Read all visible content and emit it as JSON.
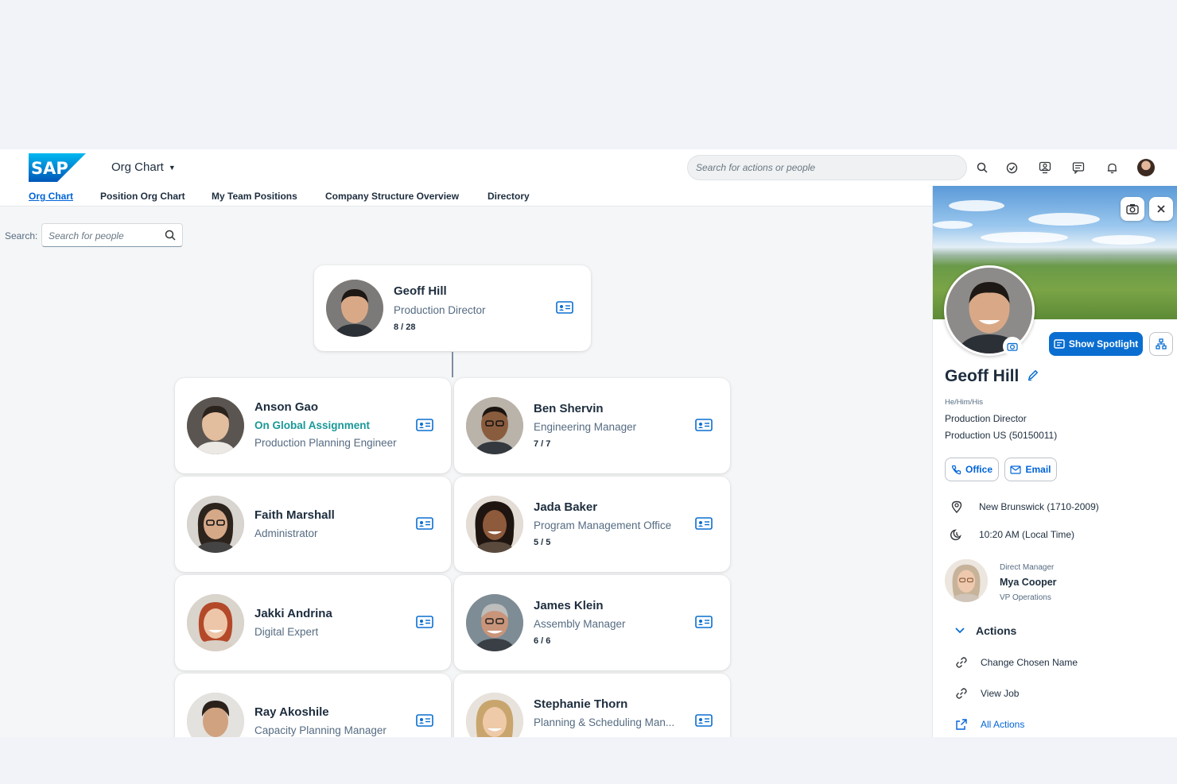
{
  "shell": {
    "logo_text": "SAP",
    "app_title": "Org Chart",
    "search_placeholder": "Search for actions or people",
    "icons": [
      "search-icon",
      "check-circle-icon",
      "people-feedback-icon",
      "notes-icon",
      "bell-icon"
    ]
  },
  "tabs": [
    {
      "label": "Org Chart",
      "active": true
    },
    {
      "label": "Position Org Chart",
      "active": false
    },
    {
      "label": "My Team Positions",
      "active": false
    },
    {
      "label": "Company Structure Overview",
      "active": false
    },
    {
      "label": "Directory",
      "active": false
    }
  ],
  "search": {
    "label": "Search:",
    "placeholder": "Search for people"
  },
  "root": {
    "name": "Geoff Hill",
    "title": "Production Director",
    "span": "8 / 28"
  },
  "reports": [
    {
      "name": "Anson Gao",
      "status": "On Global Assignment",
      "title": "Production Planning Engineer",
      "span": ""
    },
    {
      "name": "Ben Shervin",
      "status": "",
      "title": "Engineering Manager",
      "span": "7 / 7"
    },
    {
      "name": "Faith Marshall",
      "status": "",
      "title": "Administrator",
      "span": ""
    },
    {
      "name": "Jada Baker",
      "status": "",
      "title": "Program Management Office",
      "span": "5 / 5"
    },
    {
      "name": "Jakki Andrina",
      "status": "",
      "title": "Digital Expert",
      "span": ""
    },
    {
      "name": "James Klein",
      "status": "",
      "title": "Assembly Manager",
      "span": "6 / 6"
    },
    {
      "name": "Ray Akoshile",
      "status": "",
      "title": "Capacity Planning Manager",
      "span": ""
    },
    {
      "name": "Stephanie Thorn",
      "status": "",
      "title": "Planning & Scheduling Man...",
      "span": ""
    }
  ],
  "panel": {
    "show_spotlight": "Show Spotlight",
    "name": "Geoff Hill",
    "pronouns": "He/Him/His",
    "title": "Production Director",
    "org": "Production US (50150011)",
    "office_btn": "Office",
    "email_btn": "Email",
    "location": "New Brunswick (1710-2009)",
    "local_time": "10:20 AM (Local Time)",
    "manager": {
      "label": "Direct Manager",
      "name": "Mya Cooper",
      "title": "VP Operations"
    },
    "actions_title": "Actions",
    "actions": [
      {
        "label": "Change Chosen Name",
        "icon": "link-icon"
      },
      {
        "label": "View Job",
        "icon": "link-icon"
      },
      {
        "label": "All Actions",
        "icon": "share-icon"
      }
    ]
  },
  "colors": {
    "accent": "#0a6ed1",
    "link": "#0064d9",
    "global_assignment": "#1a9898",
    "text": "#1d2d3e"
  }
}
